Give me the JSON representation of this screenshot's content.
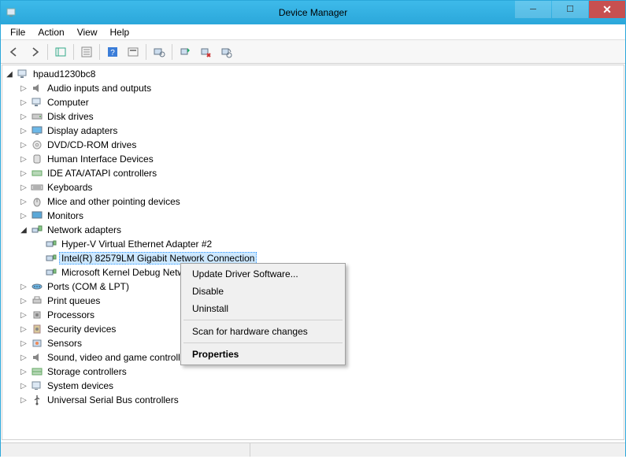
{
  "window": {
    "title": "Device Manager"
  },
  "menus": {
    "file": "File",
    "action": "Action",
    "view": "View",
    "help": "Help"
  },
  "tree": {
    "root": "hpaud1230bc8",
    "items": [
      "Audio inputs and outputs",
      "Computer",
      "Disk drives",
      "Display adapters",
      "DVD/CD-ROM drives",
      "Human Interface Devices",
      "IDE ATA/ATAPI controllers",
      "Keyboards",
      "Mice and other pointing devices",
      "Monitors"
    ],
    "network_cat": "Network adapters",
    "network_children": [
      "Hyper-V Virtual Ethernet Adapter #2",
      "Intel(R) 82579LM Gigabit Network Connection",
      "Microsoft Kernel Debug Network Adapter"
    ],
    "items_after": [
      "Ports (COM & LPT)",
      "Print queues",
      "Processors",
      "Security devices",
      "Sensors",
      "Sound, video and game controllers",
      "Storage controllers",
      "System devices",
      "Universal Serial Bus controllers"
    ]
  },
  "context_menu": {
    "update": "Update Driver Software...",
    "disable": "Disable",
    "uninstall": "Uninstall",
    "scan": "Scan for hardware changes",
    "properties": "Properties"
  }
}
